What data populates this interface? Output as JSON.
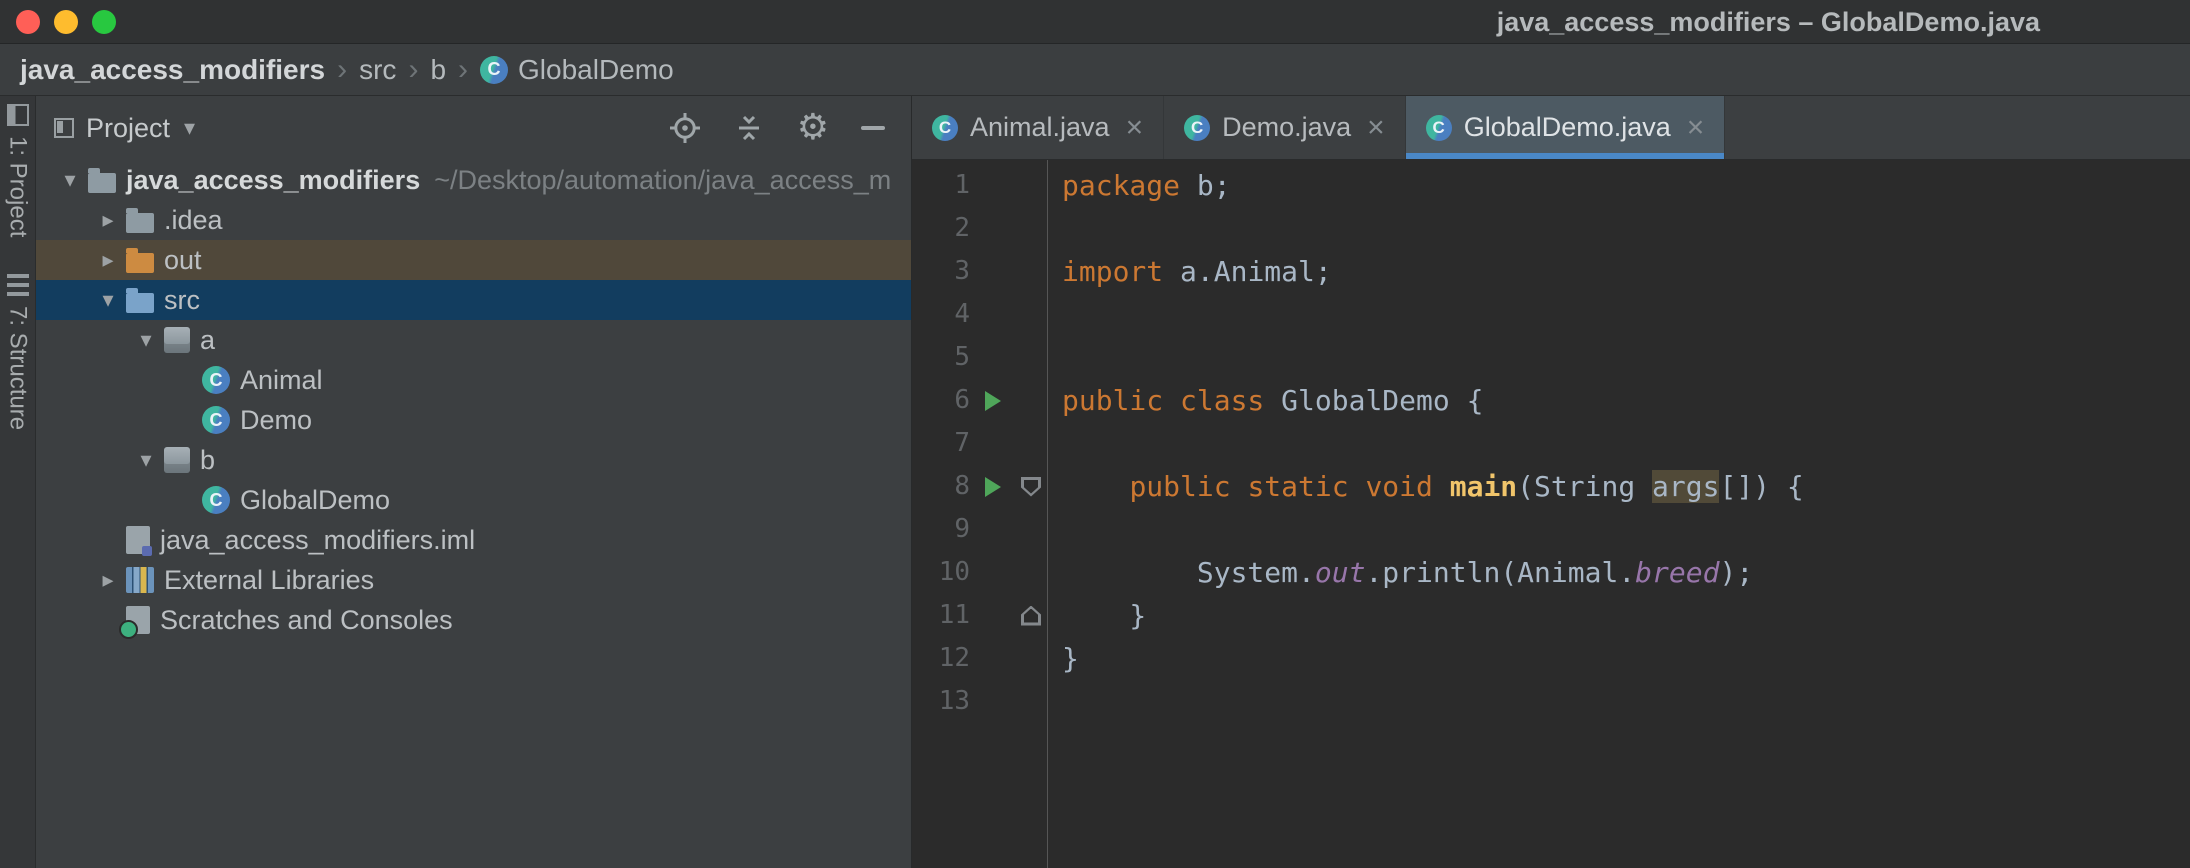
{
  "window": {
    "title": "java_access_modifiers – GlobalDemo.java"
  },
  "breadcrumbs": {
    "separator": "›",
    "items": [
      {
        "label": "java_access_modifiers",
        "bold": true
      },
      {
        "label": "src"
      },
      {
        "label": "b"
      },
      {
        "label": "GlobalDemo",
        "icon": "class"
      }
    ]
  },
  "tool_stripe": {
    "items": [
      {
        "label": "1: Project"
      },
      {
        "label": "7: Structure"
      }
    ]
  },
  "project_panel": {
    "title": "Project",
    "tree": [
      {
        "label": "java_access_modifiers",
        "suffix": "~/Desktop/automation/java_access_m",
        "icon": "project-root",
        "arrow": "open",
        "level": 0,
        "bold": true
      },
      {
        "label": ".idea",
        "icon": "folder",
        "arrow": "closed",
        "level": 1
      },
      {
        "label": "out",
        "icon": "folder-excluded",
        "arrow": "closed",
        "level": 1,
        "row": "excluded"
      },
      {
        "label": "src",
        "icon": "folder-src",
        "arrow": "open",
        "level": 1,
        "row": "selected"
      },
      {
        "label": "a",
        "icon": "package",
        "arrow": "open",
        "level": 2
      },
      {
        "label": "Animal",
        "icon": "class",
        "level": 3
      },
      {
        "label": "Demo",
        "icon": "class",
        "level": 3
      },
      {
        "label": "b",
        "icon": "package",
        "arrow": "open",
        "level": 2
      },
      {
        "label": "GlobalDemo",
        "icon": "class",
        "level": 3
      },
      {
        "label": "java_access_modifiers.iml",
        "icon": "module",
        "level": 1
      },
      {
        "label": "External Libraries",
        "icon": "libraries",
        "arrow": "closed",
        "level": 1
      },
      {
        "label": "Scratches and Consoles",
        "icon": "scratches",
        "level": 1
      }
    ]
  },
  "editor": {
    "class_icon_letter": "C",
    "tabs": [
      {
        "label": "Animal.java",
        "icon": "class",
        "active": false,
        "close": "×"
      },
      {
        "label": "Demo.java",
        "icon": "class",
        "active": false,
        "close": "×"
      },
      {
        "label": "GlobalDemo.java",
        "icon": "class",
        "active": true,
        "close": "×"
      }
    ],
    "code_lines": [
      {
        "n": 1,
        "tokens": [
          {
            "t": "package",
            "c": "kw"
          },
          {
            "t": " b;",
            "c": "pl"
          }
        ]
      },
      {
        "n": 2,
        "tokens": []
      },
      {
        "n": 3,
        "tokens": [
          {
            "t": "import",
            "c": "kw"
          },
          {
            "t": " a.Animal;",
            "c": "pl"
          }
        ]
      },
      {
        "n": 4,
        "tokens": []
      },
      {
        "n": 5,
        "tokens": []
      },
      {
        "n": 6,
        "run": true,
        "tokens": [
          {
            "t": "public class ",
            "c": "kw"
          },
          {
            "t": "GlobalDemo {",
            "c": "pl"
          }
        ]
      },
      {
        "n": 7,
        "tokens": []
      },
      {
        "n": 8,
        "run": true,
        "fold": "open",
        "tokens": [
          {
            "t": "    ",
            "c": "pl"
          },
          {
            "t": "public static void ",
            "c": "kw"
          },
          {
            "t": "main",
            "c": "fn"
          },
          {
            "t": "(String ",
            "c": "pl"
          },
          {
            "t": "args",
            "c": "pl hl"
          },
          {
            "t": "[]) {",
            "c": "pl"
          }
        ]
      },
      {
        "n": 9,
        "tokens": []
      },
      {
        "n": 10,
        "tokens": [
          {
            "t": "        System.",
            "c": "pl"
          },
          {
            "t": "out",
            "c": "fld"
          },
          {
            "t": ".println(Animal.",
            "c": "pl"
          },
          {
            "t": "breed",
            "c": "fld"
          },
          {
            "t": ");",
            "c": "pl"
          }
        ]
      },
      {
        "n": 11,
        "fold": "close",
        "tokens": [
          {
            "t": "    }",
            "c": "pl"
          }
        ]
      },
      {
        "n": 12,
        "tokens": [
          {
            "t": "}",
            "c": "pl"
          }
        ]
      },
      {
        "n": 13,
        "tokens": []
      }
    ]
  },
  "colors": {
    "traffic_red": "#ff5f57",
    "traffic_yellow": "#febc2e",
    "traffic_green": "#28c840",
    "accent_underline": "#4a88c7",
    "keyword": "#cc7832",
    "plain_text": "#a9b7c6",
    "method_decl": "#f1c56b",
    "static_member": "#9876aa",
    "run_arrow": "#4fa65a",
    "selected_row": "#123d5f",
    "excluded_row": "#50483a",
    "occurrence_bg": "#514a38",
    "editor_bg": "#2b2b2b",
    "panel_bg": "#3c3f41"
  }
}
